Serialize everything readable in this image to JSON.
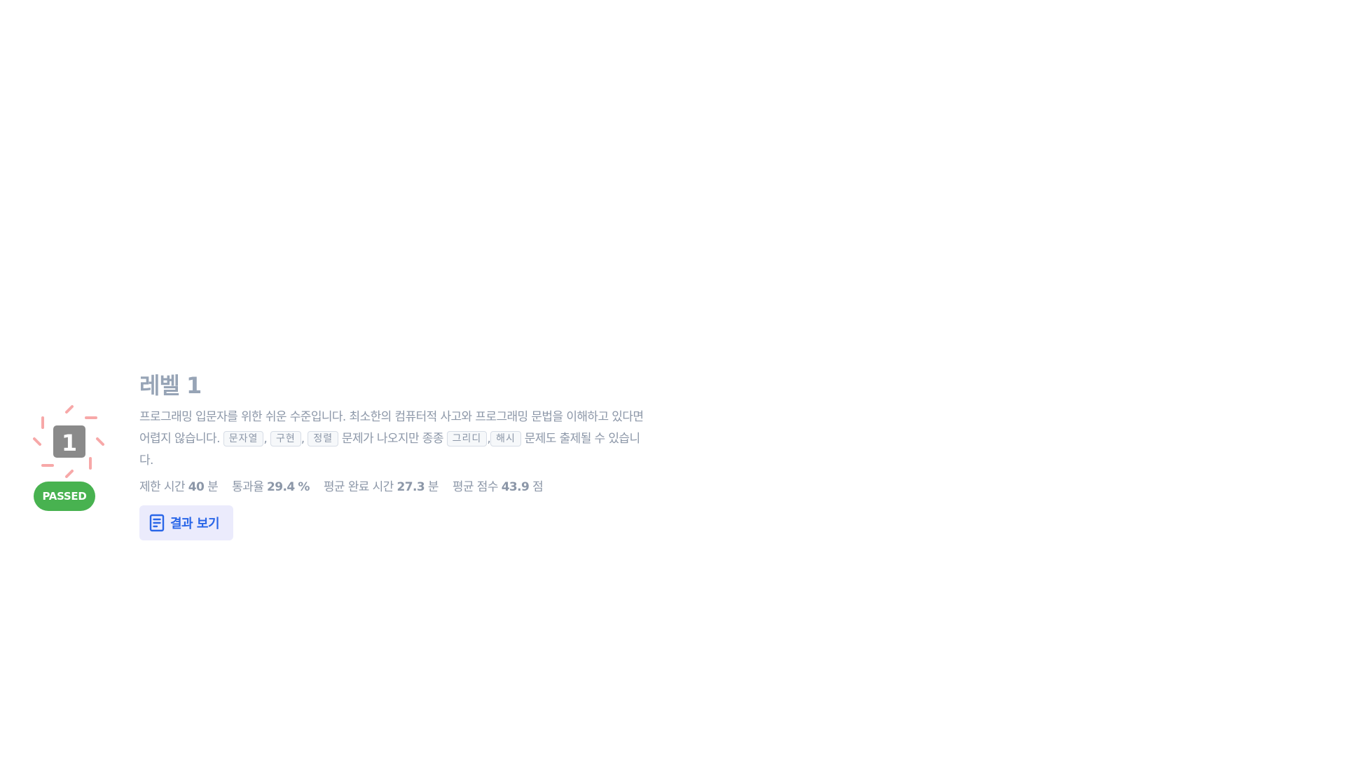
{
  "level": {
    "icon_number": "1",
    "status_badge": "PASSED",
    "title": "레벨 1",
    "description": {
      "text_1": "프로그래밍 입문자를 위한 쉬운 수준입니다. 최소한의 컴퓨터적 사고와 프로그래밍 문법을 이해하고 있다면 어렵지 않습니다. ",
      "tags_1": [
        "문자열",
        "구현",
        "정렬"
      ],
      "text_2": " 문제가 나오지만 종종 ",
      "tags_2": [
        "그리디",
        "해시"
      ],
      "text_3": " 문제도 출제될 수 있습니다."
    },
    "stats": [
      {
        "label": "제한 시간",
        "value": "40",
        "unit": "분"
      },
      {
        "label": "통과율",
        "value": "29.4",
        "unit": "%"
      },
      {
        "label": "평균 완료 시간",
        "value": "27.3",
        "unit": "분"
      },
      {
        "label": "평균 점수",
        "value": "43.9",
        "unit": "점"
      }
    ],
    "view_result_label": "결과 보기"
  },
  "colors": {
    "passed_green": "#48b250",
    "title_gray": "#97a4b6",
    "button_bg": "#ebebfc",
    "button_text": "#2a66e8",
    "sparkle_red": "#f7a8a8",
    "icon_box": "#8a8a8a"
  },
  "icons": {
    "level_icon": "level-number-sparkle-icon",
    "result_icon": "document-icon"
  }
}
